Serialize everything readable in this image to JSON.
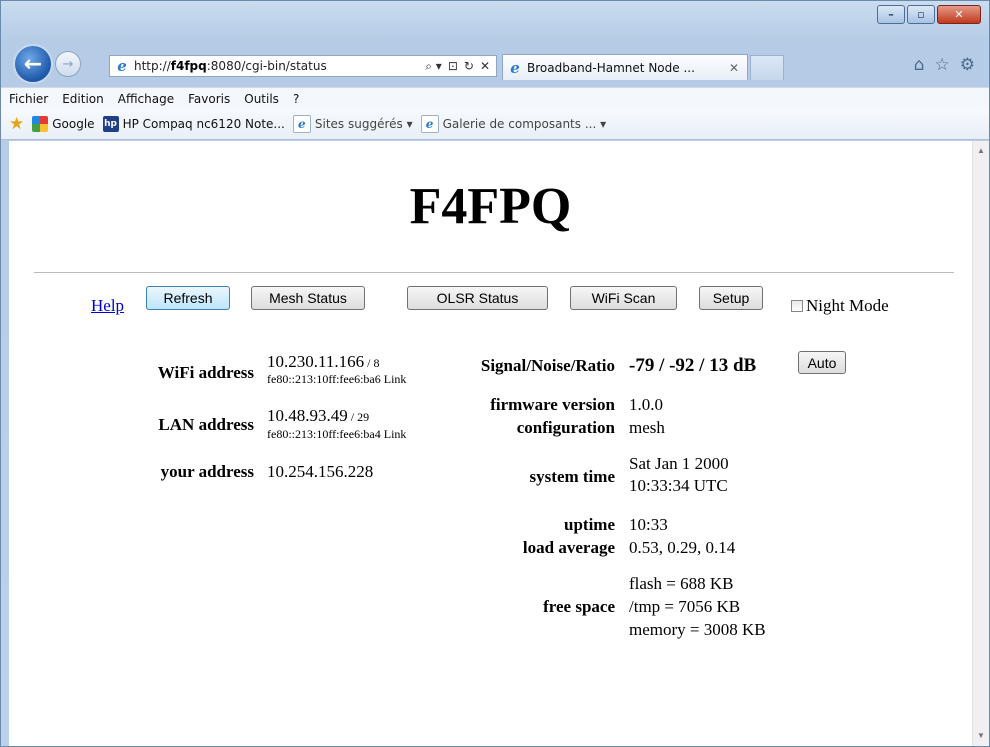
{
  "browser": {
    "url_prefix": "http://",
    "url_host": "f4fpq",
    "url_rest": ":8080/cgi-bin/status",
    "url_controls": [
      "⌕ ▾",
      "⊡",
      "↻",
      "✕"
    ],
    "tab_title": "Broadband-Hamnet Node ...",
    "tab_close": "✕",
    "caption": [
      "–",
      "▫",
      "✕"
    ],
    "menu": [
      "Fichier",
      "Edition",
      "Affichage",
      "Favoris",
      "Outils",
      "?"
    ],
    "favorites": [
      "Google",
      "HP Compaq nc6120 Note...",
      "Sites suggérés ▾",
      "Galerie de composants ... ▾"
    ],
    "toolbar_icons": [
      "⌂",
      "☆",
      "⚙"
    ],
    "favorite_icons": [
      "g",
      "hp",
      "e",
      "e"
    ]
  },
  "page": {
    "title": "F4FPQ",
    "help_link": "Help",
    "buttons": [
      "Refresh",
      "Mesh Status",
      "OLSR Status",
      "WiFi Scan",
      "Setup"
    ],
    "night_mode_label": "Night Mode",
    "night_mode_checked": false,
    "wifi": {
      "label": "WiFi address",
      "ip": "10.230.11.166",
      "prefix": " / 8",
      "ipv6": "fe80::213:10ff:fee6:ba6 Link"
    },
    "lan": {
      "label": "LAN address",
      "ip": "10.48.93.49",
      "prefix": " / 29",
      "ipv6": "fe80::213:10ff:fee6:ba4 Link"
    },
    "your_address": {
      "label": "your address",
      "value": "10.254.156.228"
    },
    "signal": {
      "label": "Signal/Noise/Ratio",
      "value": "-79 / -92 / 13 dB",
      "auto_button": "Auto"
    },
    "firmware": {
      "label": "firmware version",
      "value": "1.0.0"
    },
    "configuration": {
      "label": "configuration",
      "value": "mesh"
    },
    "system_time": {
      "label": "system time",
      "line1": "Sat Jan 1 2000",
      "line2": "10:33:34 UTC"
    },
    "uptime": {
      "label": "uptime",
      "value": "10:33"
    },
    "load_average": {
      "label": "load average",
      "value": "0.53, 0.29, 0.14"
    },
    "free_space": {
      "label": "free space",
      "flash": "flash = 688 KB",
      "tmp": "/tmp = 7056 KB",
      "memory": "memory = 3008 KB"
    }
  },
  "scroll": {
    "up": "▲",
    "down": "▼"
  }
}
